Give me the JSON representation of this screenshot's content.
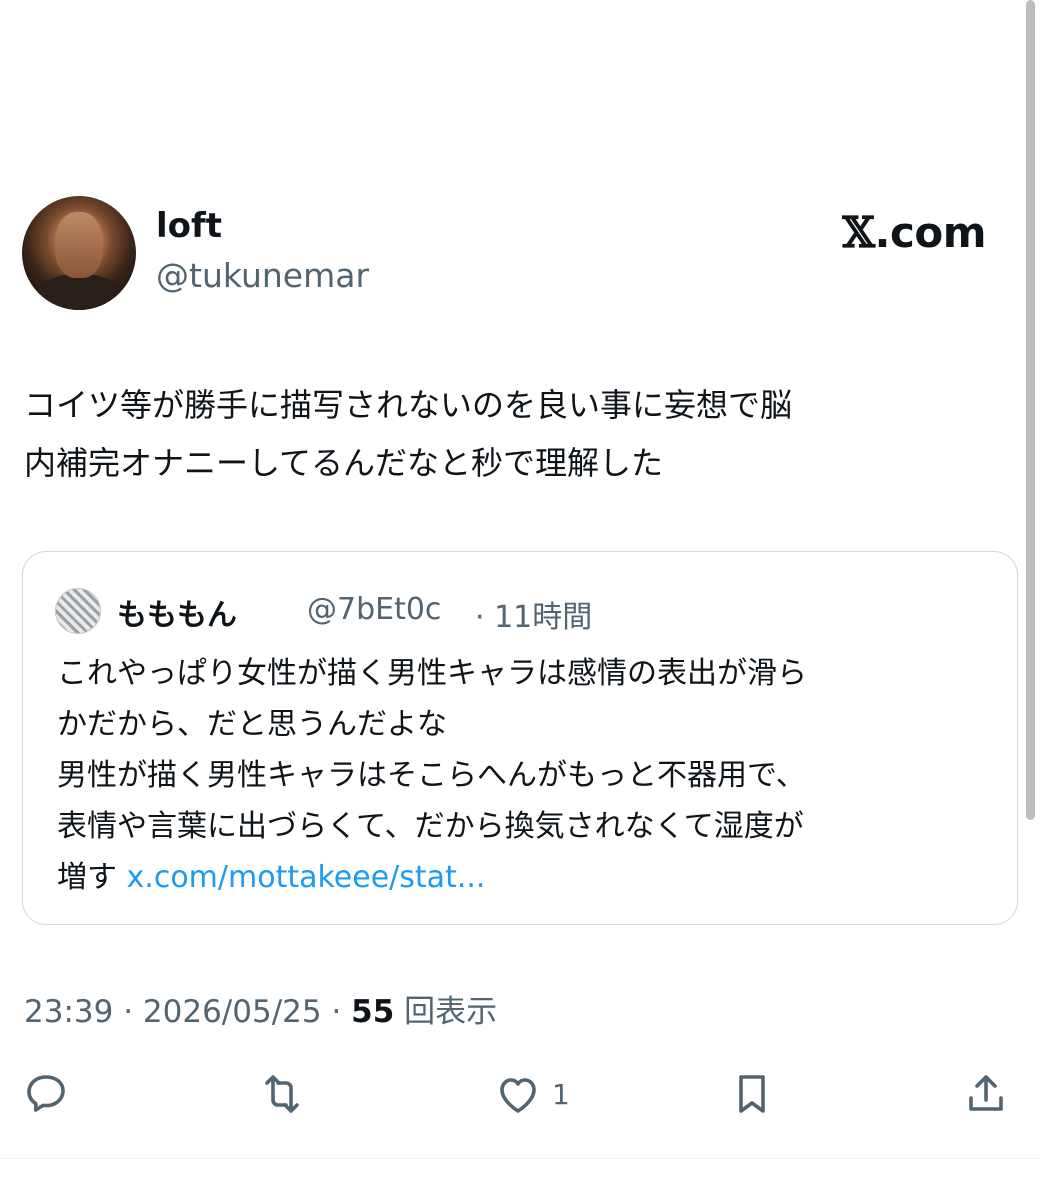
{
  "author": {
    "name": "loft",
    "handle": "@tukunemar"
  },
  "brand": {
    "mark": "𝕏",
    "suffix": ".com"
  },
  "tweet": {
    "lines": [
      "コイツ等が勝手に描写されないのを良い事に妄想で脳",
      "内補完オナニーしてるんだなと秒で理解した"
    ]
  },
  "quote": {
    "name": "もももん",
    "handle": "@7bEt0c",
    "time": "· 11時間",
    "lines": [
      "これやっぱり女性が描く男性キャラは感情の表出が滑ら",
      "かだから、だと思うんだよな",
      "男性が描く男性キャラはそこらへんがもっと不器用で、",
      "表情や言葉に出づらくて、だから換気されなくて湿度が"
    ],
    "last_line_prefix": "増す ",
    "link": "x.com/mottakeee/stat..."
  },
  "meta": {
    "time": "23:39",
    "sep1": " · ",
    "date": "2026/05/25",
    "sep2": " · ",
    "views_count": "55",
    "views_label": " 回表示"
  },
  "actions": {
    "like_count": "1"
  },
  "colors": {
    "text": "#0f1419",
    "secondary": "#536471",
    "link": "#1d9bf0",
    "border": "#cfd9de"
  }
}
